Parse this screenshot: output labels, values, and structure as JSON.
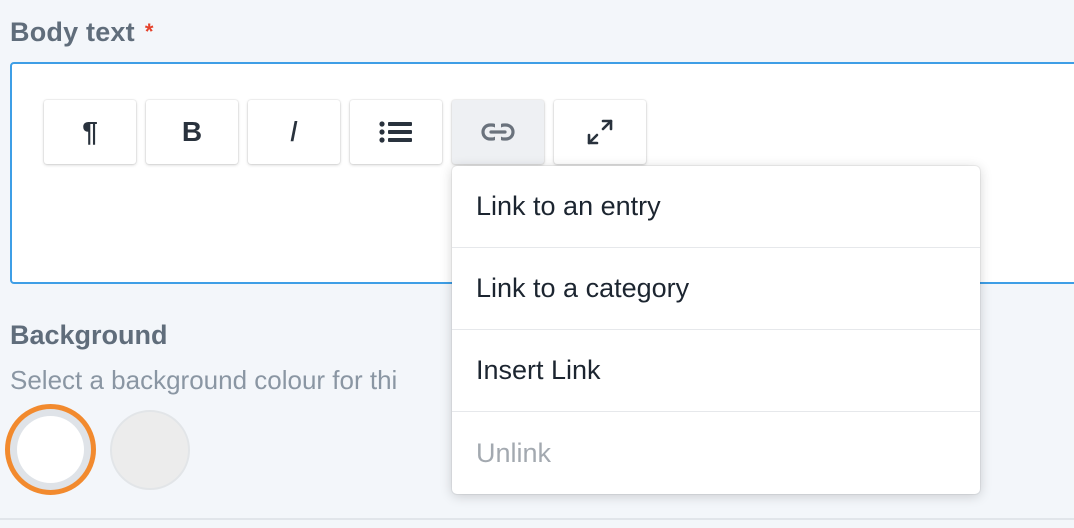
{
  "body_field": {
    "label": "Body text",
    "required_mark": "*"
  },
  "toolbar": {
    "buttons": [
      {
        "name": "paragraph",
        "glyph": "¶",
        "icon": "pilcrow-icon"
      },
      {
        "name": "bold",
        "glyph": "B",
        "icon": "bold-icon"
      },
      {
        "name": "italic",
        "glyph": "I",
        "icon": "italic-icon"
      },
      {
        "name": "list",
        "icon": "unordered-list-icon"
      },
      {
        "name": "link",
        "icon": "link-icon",
        "active": true
      },
      {
        "name": "fullscreen",
        "icon": "expand-icon"
      }
    ]
  },
  "link_menu": {
    "items": [
      {
        "label": "Link to an entry"
      },
      {
        "label": "Link to a category"
      },
      {
        "label": "Insert Link"
      },
      {
        "label": "Unlink",
        "disabled": true
      }
    ]
  },
  "background_field": {
    "label": "Background",
    "instructions": "Select a background colour for thi"
  },
  "swatches": [
    {
      "color": "#ffffff",
      "selected": true,
      "ring_color": "#f28a2e"
    },
    {
      "color": "#ececec",
      "selected": false
    }
  ]
}
